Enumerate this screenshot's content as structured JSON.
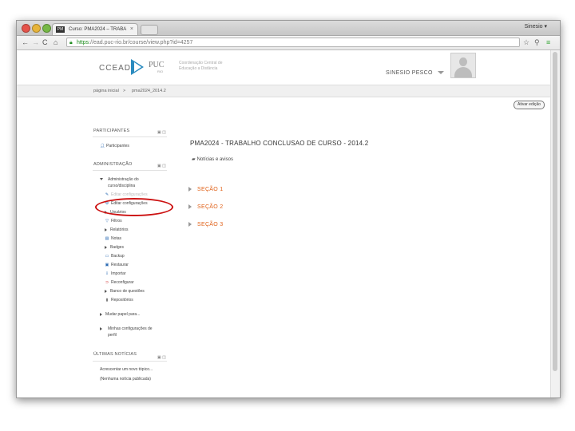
{
  "browser": {
    "tab_title": "Curso: PMA2024 – TRABA",
    "tab_favicon": "PM",
    "user_chip": "Sinesio ▾",
    "url_https": "https",
    "url_rest": "://ead.puc-rio.br/course/view.php?id=4257"
  },
  "header": {
    "logo_ccead": "CCEAD",
    "logo_puc": "PUC",
    "logo_rio": "RIO",
    "logo_desc": "Coordenação Central de Educação a Distância",
    "username": "SINESIO PESCO"
  },
  "breadcrumb": {
    "home": "página inicial",
    "separator": ">",
    "current": "pma2024_2014.2"
  },
  "edit_button": "Ativar edição",
  "blocks": {
    "participants": {
      "title": "PARTICIPANTES",
      "item": "Participantes"
    },
    "admin": {
      "title": "ADMINISTRAÇÃO",
      "course_admin": "Administração do curso/disciplina",
      "items": [
        {
          "label": "Editar configurações",
          "icon": "edit-icon"
        },
        {
          "label": "Editar configurações",
          "icon": "settings-icon"
        },
        {
          "label": "Usuários",
          "icon": "users-icon"
        },
        {
          "label": "Filtros",
          "icon": "filter-icon"
        },
        {
          "label": "Relatórios",
          "icon": "reports-icon"
        },
        {
          "label": "Notas",
          "icon": "grades-icon"
        },
        {
          "label": "Badges",
          "icon": "badges-icon"
        },
        {
          "label": "Backup",
          "icon": "backup-icon"
        },
        {
          "label": "Restaurar",
          "icon": "restore-icon"
        },
        {
          "label": "Importar",
          "icon": "import-icon"
        },
        {
          "label": "Reconfigurar",
          "icon": "reset-icon"
        },
        {
          "label": "Banco de questões",
          "icon": "question-bank-icon"
        },
        {
          "label": "Repositórios",
          "icon": "repository-icon"
        }
      ],
      "switch_role": "Mudar papel para...",
      "profile_settings": "Minhas configurações de perfil"
    },
    "news": {
      "title": "ÚLTIMAS NOTÍCIAS",
      "add_topic": "Acrescentar um novo tópico...",
      "empty": "(Nenhuma notícia publicada)"
    }
  },
  "main": {
    "course_title": "PMA2024 - TRABALHO CONCLUSAO DE CURSO - 2014.2",
    "news_forum": "Notícias e avisos",
    "sections": [
      "SEÇÃO 1",
      "SEÇÃO 2",
      "SEÇÃO 3"
    ]
  },
  "colors": {
    "section_orange": "#e0621a",
    "highlight_red": "#cc1111",
    "logo_blue": "#2a8bbf"
  }
}
